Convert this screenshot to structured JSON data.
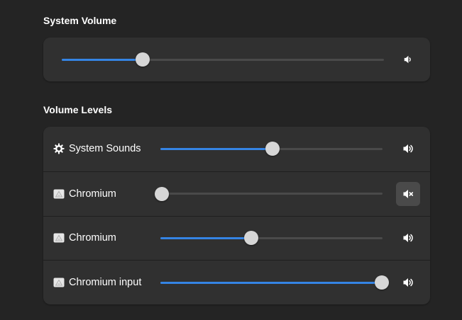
{
  "system_volume": {
    "title": "System Volume",
    "level": 0.25,
    "speaker_icon": "audio-volume-medium-icon"
  },
  "volume_levels": {
    "title": "Volume Levels",
    "rows": [
      {
        "label": "System Sounds",
        "icon": "gear-icon",
        "level": 0.505,
        "muted": false,
        "speaker_icon": "audio-volume-high-icon"
      },
      {
        "label": "Chromium",
        "icon": "app-window-icon",
        "level": 0.0,
        "muted": true,
        "speaker_icon": "audio-volume-muted-icon"
      },
      {
        "label": "Chromium",
        "icon": "app-window-icon",
        "level": 0.41,
        "muted": false,
        "speaker_icon": "audio-volume-high-icon"
      },
      {
        "label": "Chromium input",
        "icon": "app-window-icon",
        "level": 1.0,
        "muted": false,
        "speaker_icon": "audio-volume-high-icon"
      }
    ]
  },
  "colors": {
    "background": "#242424",
    "card": "#303030",
    "accent": "#3584e4",
    "track": "#4a4a4a",
    "knob": "#d6d6d6"
  }
}
